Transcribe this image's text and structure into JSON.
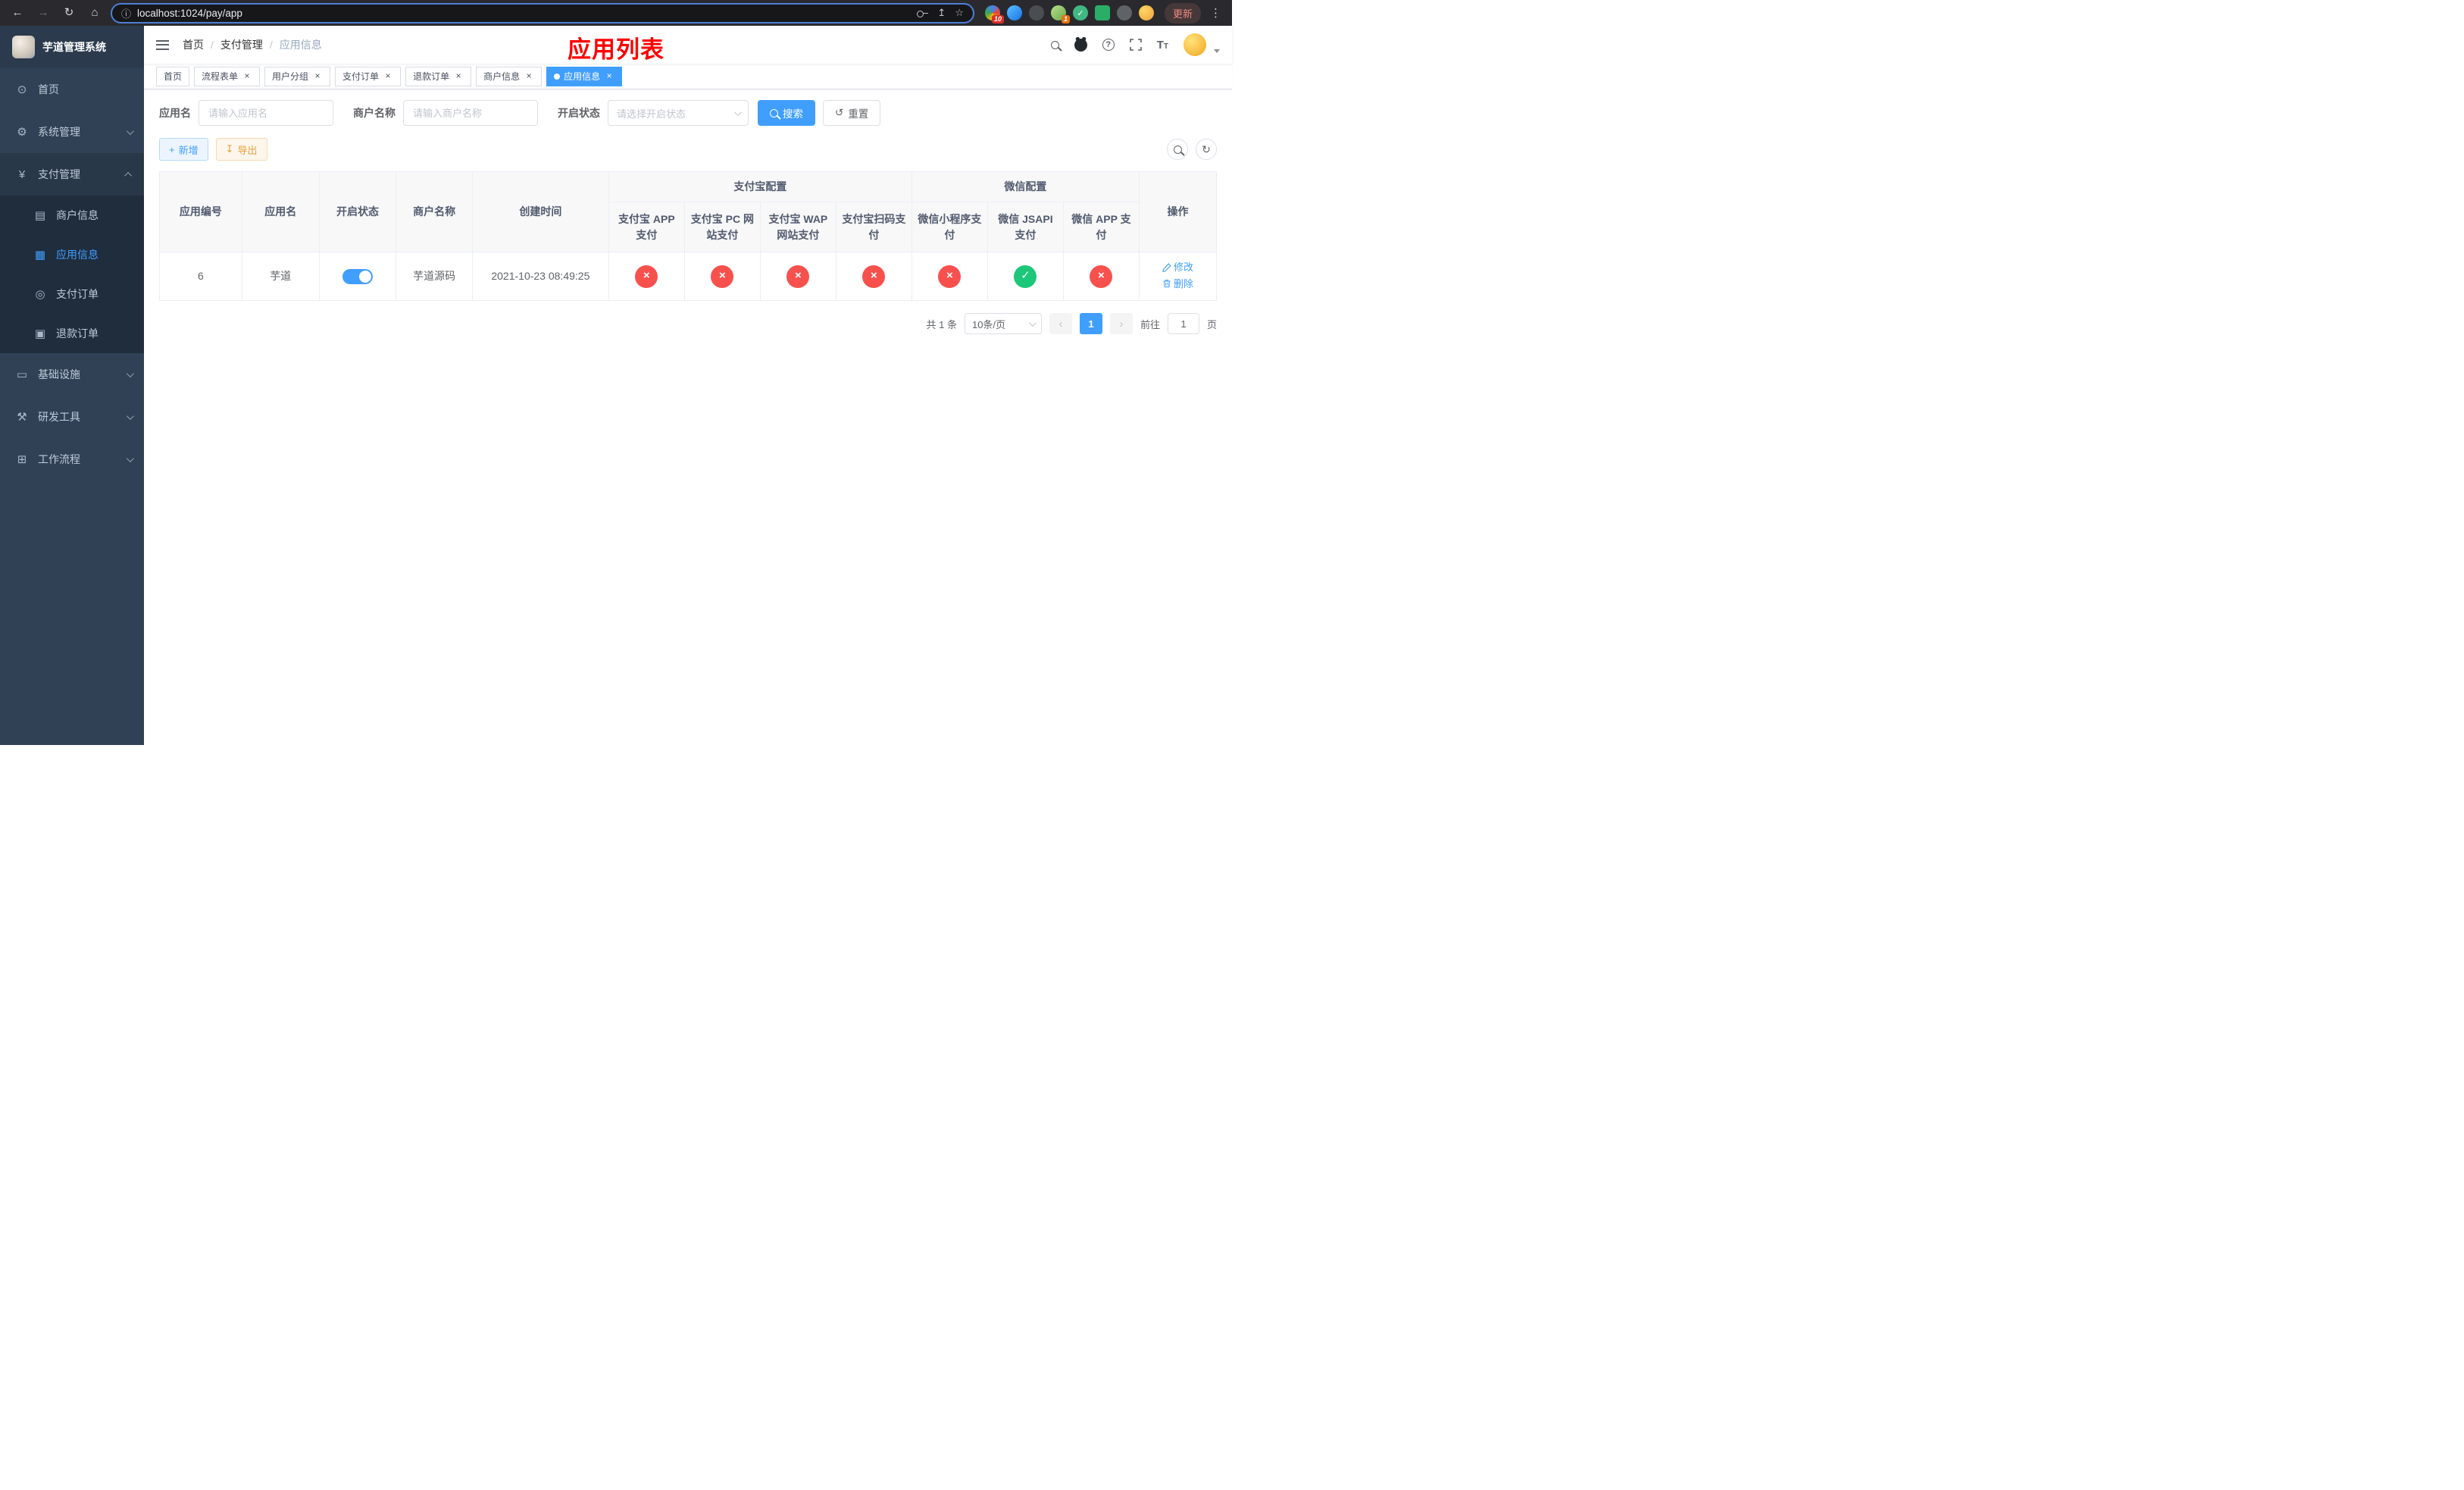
{
  "browser": {
    "url": "localhost:1024/pay/app",
    "update_label": "更新",
    "ext_badge_primary": "10",
    "ext_badge_profile": "1"
  },
  "sidebar": {
    "title": "芋道管理系统",
    "items": [
      {
        "label": "首页"
      },
      {
        "label": "系统管理"
      },
      {
        "label": "支付管理"
      },
      {
        "label": "基础设施"
      },
      {
        "label": "研发工具"
      },
      {
        "label": "工作流程"
      }
    ],
    "payment_children": [
      {
        "label": "商户信息"
      },
      {
        "label": "应用信息"
      },
      {
        "label": "支付订单"
      },
      {
        "label": "退款订单"
      }
    ]
  },
  "header": {
    "breadcrumb": [
      "首页",
      "支付管理",
      "应用信息"
    ],
    "overlay_title": "应用列表"
  },
  "tabs": [
    {
      "label": "首页",
      "closable": false,
      "active": false
    },
    {
      "label": "流程表单",
      "closable": true,
      "active": false
    },
    {
      "label": "用户分组",
      "closable": true,
      "active": false
    },
    {
      "label": "支付订单",
      "closable": true,
      "active": false
    },
    {
      "label": "退款订单",
      "closable": true,
      "active": false
    },
    {
      "label": "商户信息",
      "closable": true,
      "active": false
    },
    {
      "label": "应用信息",
      "closable": true,
      "active": true
    }
  ],
  "filters": {
    "app_name_label": "应用名",
    "app_name_placeholder": "请输入应用名",
    "merchant_label": "商户名称",
    "merchant_placeholder": "请输入商户名称",
    "status_label": "开启状态",
    "status_placeholder": "请选择开启状态",
    "search_label": "搜索",
    "reset_label": "重置"
  },
  "toolbar": {
    "add_label": "新增",
    "export_label": "导出"
  },
  "table": {
    "main_columns": [
      "应用编号",
      "应用名",
      "开启状态",
      "商户名称",
      "创建时间"
    ],
    "alipay_group": "支付宝配置",
    "alipay_columns": [
      "支付宝 APP 支付",
      "支付宝 PC 网站支付",
      "支付宝 WAP 网站支付",
      "支付宝扫码支付"
    ],
    "wechat_group": "微信配置",
    "wechat_columns": [
      "微信小程序支付",
      "微信 JSAPI 支付",
      "微信 APP 支付"
    ],
    "ops_column": "操作",
    "edit_label": "修改",
    "delete_label": "删除",
    "rows": [
      {
        "id": "6",
        "name": "芋道",
        "enabled": true,
        "merchant": "芋道源码",
        "created": "2021-10-23 08:49:25",
        "configs": [
          false,
          false,
          false,
          false,
          false,
          true,
          false
        ]
      }
    ]
  },
  "pagination": {
    "total": "共 1 条",
    "page_size": "10条/页",
    "page": "1",
    "goto_label": "前往",
    "goto_value": "1",
    "unit_label": "页"
  }
}
